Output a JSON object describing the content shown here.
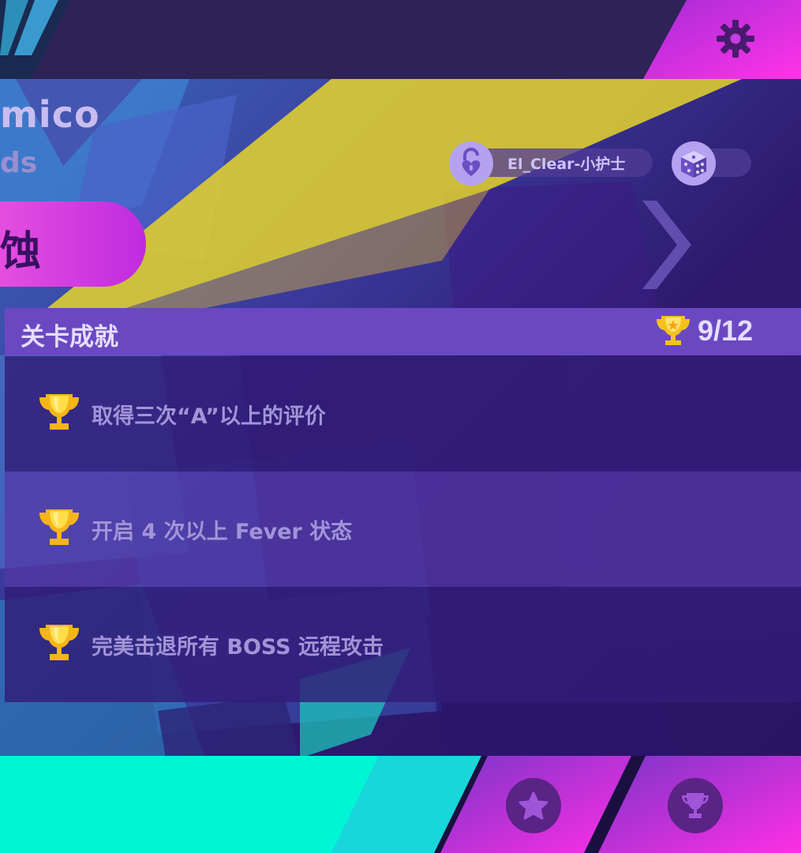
{
  "song": {
    "title_fragment": "mico",
    "subtitle_fragment": "ds"
  },
  "author": {
    "name": "El_Clear-小护士"
  },
  "mode": {
    "label_fragment": "蚀"
  },
  "achievements": {
    "title": "关卡成就",
    "count": "9/12",
    "items": [
      {
        "text": "取得三次“A”以上的评价"
      },
      {
        "text": "开启 4 次以上 Fever 状态"
      },
      {
        "text": "完美击退所有 BOSS 远程攻击"
      }
    ]
  },
  "icons": {
    "settings": "gear-icon",
    "author": "lock-heart-icon",
    "random": "dice-icon",
    "next": "chevron-right-icon",
    "trophy": "trophy-icon",
    "favorite": "star-icon",
    "achievements_nav": "trophy-icon"
  },
  "colors": {
    "accent_pink": "#e040e0",
    "panel_purple": "#6a48c2",
    "cyan": "#00f5d4",
    "trophy_gold": "#f5c21a"
  }
}
